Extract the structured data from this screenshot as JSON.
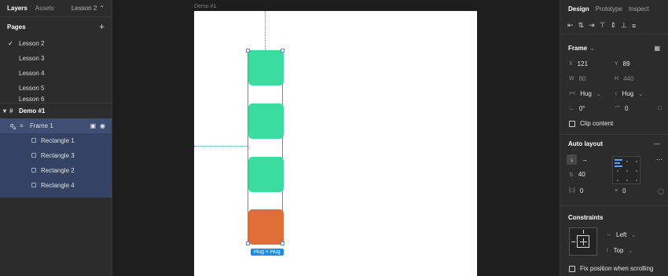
{
  "left_panel": {
    "tabs": [
      "Layers",
      "Assets"
    ],
    "current_page": "Lesson 2",
    "pages_title": "Pages",
    "pages": [
      "Lesson 2",
      "Lesson 3",
      "Lesson 4",
      "Lesson 5",
      "Lesson 6"
    ],
    "layers": {
      "frame": "Demo #1",
      "selected": "Frame 1",
      "children": [
        "Rectangle 1",
        "Rectangle 3",
        "Rectangle 2",
        "Rectangle 4"
      ]
    }
  },
  "canvas": {
    "frame_title": "Demo #1",
    "hug_badge": "Hug × Hug",
    "rect_colors": [
      "#3bdca0",
      "#3bdca0",
      "#3bdca0",
      "#e06c36"
    ]
  },
  "right_panel": {
    "tabs": [
      "Design",
      "Prototype",
      "Inspect"
    ],
    "frame_section": "Frame",
    "x_label": "X",
    "x_value": "121",
    "y_label": "Y",
    "y_value": "89",
    "w_label": "W",
    "w_value": "80",
    "h_label": "H",
    "h_value": "440",
    "hug_w": "Hug",
    "hug_h": "Hug",
    "rotation": "0°",
    "radius": "0",
    "clip_content": "Clip content",
    "auto_layout_section": "Auto layout",
    "spacing": "40",
    "padding_h": "0",
    "padding_v": "0",
    "constraints_section": "Constraints",
    "constraint_h": "Left",
    "constraint_v": "Top",
    "fix_position": "Fix position when scrolling"
  },
  "colors": {
    "accent": "#1a8cf0",
    "green": "#3bdca0",
    "orange": "#e06c36",
    "selection": "#3e4f73"
  }
}
